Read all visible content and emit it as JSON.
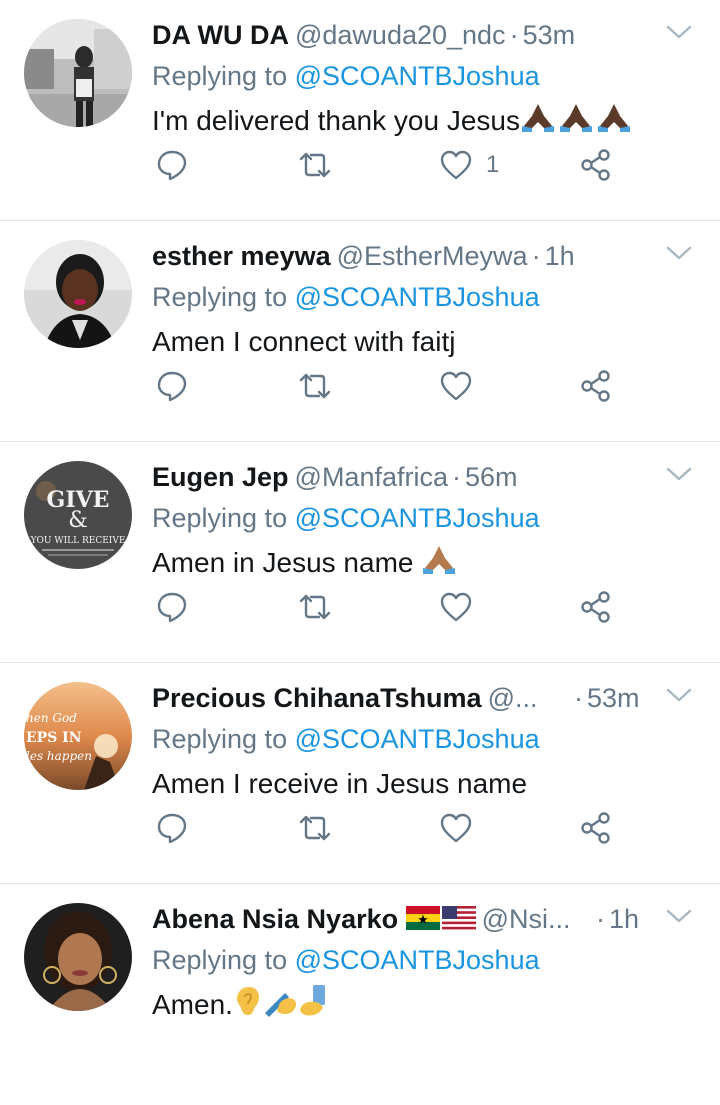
{
  "colors": {
    "link": "#1b95e0",
    "muted": "#657786",
    "text": "#14171a",
    "divider": "#e1e8ed"
  },
  "tweets": [
    {
      "name": "DA WU DA",
      "handle": "@dawuda20_ndc",
      "separator": "·",
      "time": "53m",
      "replying_label": "Replying to",
      "mention": "@SCOANTBJoshua",
      "text": "I'm delivered thank you Jesus",
      "emoji": [
        "folded-hands-dark",
        "folded-hands-dark",
        "folded-hands-dark"
      ],
      "like_count": "1"
    },
    {
      "name": "esther meywa",
      "handle": "@EstherMeywa",
      "separator": "·",
      "time": "1h",
      "replying_label": "Replying to",
      "mention": "@SCOANTBJoshua",
      "text": "Amen I connect with faitj",
      "emoji": [],
      "like_count": ""
    },
    {
      "name": "Eugen Jep",
      "handle": "@Manfafrica",
      "separator": "·",
      "time": "56m",
      "replying_label": "Replying to",
      "mention": "@SCOANTBJoshua",
      "text": "Amen in Jesus name",
      "emoji": [
        "folded-hands-medium"
      ],
      "like_count": ""
    },
    {
      "name": "Precious ChihanaTshuma",
      "handle": "@...",
      "separator": "·",
      "time": "53m",
      "replying_label": "Replying to",
      "mention": "@SCOANTBJoshua",
      "text": "Amen I receive in Jesus name",
      "emoji": [],
      "like_count": ""
    },
    {
      "name": "Abena Nsia Nyarko",
      "name_flags": [
        "flag-ghana",
        "flag-usa"
      ],
      "handle": "@Nsi...",
      "separator": "·",
      "time": "1h",
      "replying_label": "Replying to",
      "mention": "@SCOANTBJoshua",
      "text": "Amen.",
      "emoji": [
        "ear",
        "writing-hand",
        "selfie"
      ],
      "like_count": ""
    }
  ],
  "avatar_texts": {
    "eugen": [
      "GIVE",
      "&",
      "YOU WILL RECEIVE"
    ],
    "precious": [
      "hen God",
      "EPS IN",
      "les happen"
    ]
  }
}
